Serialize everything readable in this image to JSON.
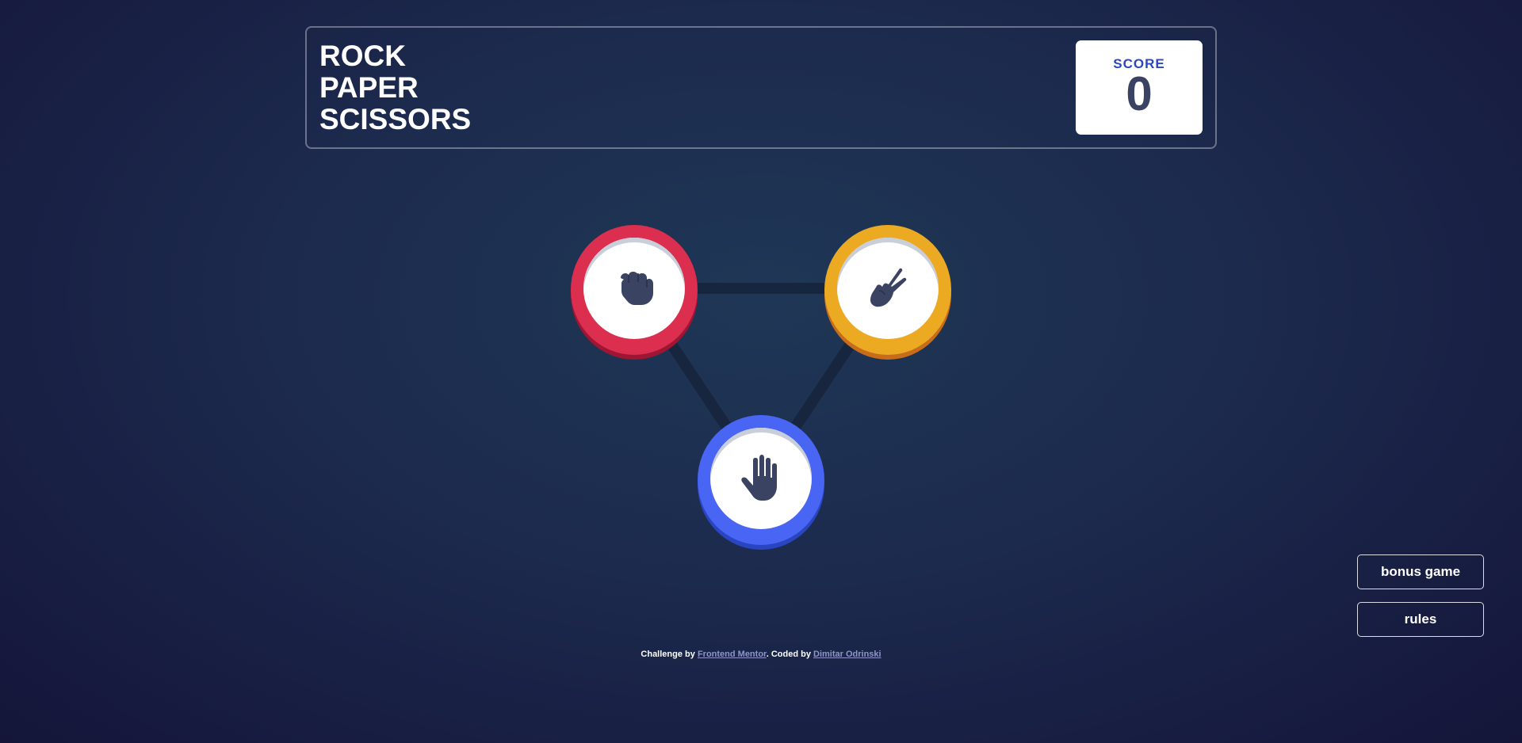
{
  "header": {
    "title_lines": [
      "ROCK",
      "PAPER",
      "SCISSORS"
    ],
    "score_label": "SCORE",
    "score_value": "0"
  },
  "tokens": [
    {
      "name": "rock",
      "icon": "fist-icon",
      "color": "#dc2e4e"
    },
    {
      "name": "scissors",
      "icon": "scissors-hand-icon",
      "color": "#eca922"
    },
    {
      "name": "paper",
      "icon": "open-hand-icon",
      "color": "#4865f4"
    }
  ],
  "buttons": {
    "bonus_label": "bonus game",
    "rules_label": "rules"
  },
  "footer": {
    "prefix": "Challenge by ",
    "link1": "Frontend Mentor",
    "middle": ". Coded by ",
    "link2": "Dimitar Odrinski"
  },
  "colors": {
    "rock": "#dc2e4e",
    "scissors": "#eca922",
    "paper": "#4865f4",
    "score_label": "#2a46c0",
    "score_value": "#3b4363"
  }
}
